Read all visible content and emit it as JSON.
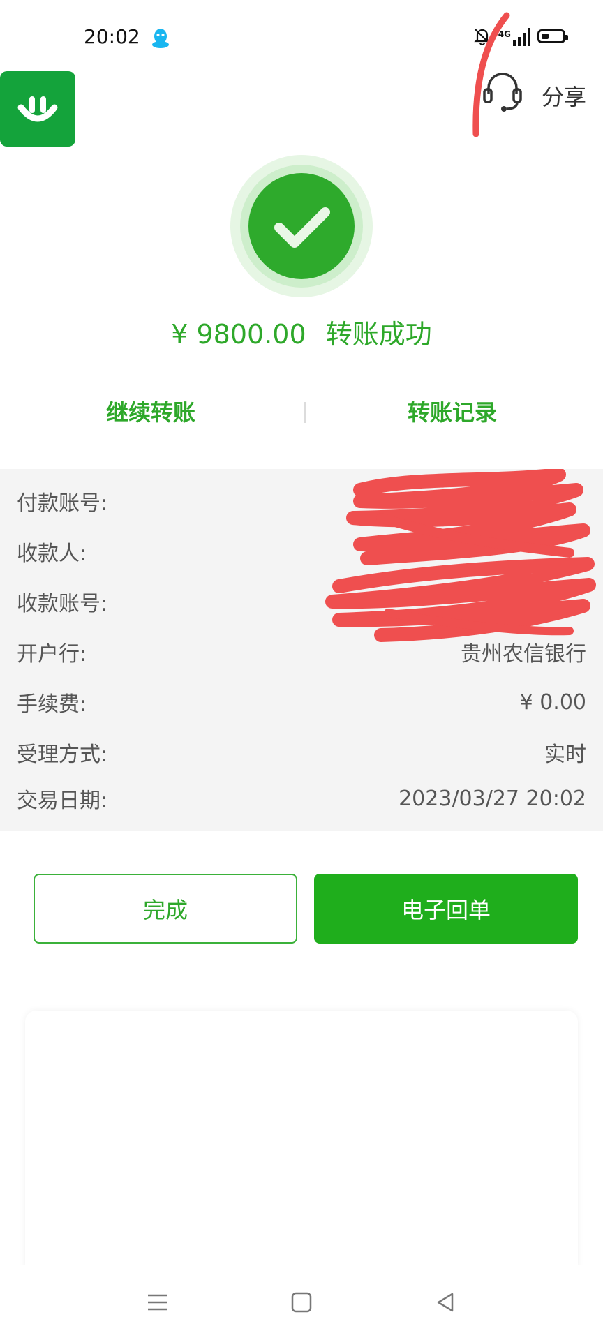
{
  "status_bar": {
    "time": "20:02",
    "network": "4G",
    "icons": [
      "qq-icon",
      "bell-off-icon",
      "signal-icon",
      "battery-icon"
    ]
  },
  "header": {
    "logo_icon": "smile-logo-icon",
    "support_icon": "headset-icon",
    "share_label": "分享"
  },
  "result": {
    "icon": "checkmark-icon",
    "amount": "¥ 9800.00",
    "status": "转账成功"
  },
  "actions": {
    "continue_label": "继续转账",
    "records_label": "转账记录"
  },
  "details": [
    {
      "label": "付款账号:",
      "value": "",
      "redacted": true
    },
    {
      "label": "收款人:",
      "value": "",
      "redacted": true
    },
    {
      "label": "收款账号:",
      "value": "",
      "redacted": true
    },
    {
      "label": "开户行:",
      "value": "贵州农信银行"
    },
    {
      "label": "手续费:",
      "value": "¥ 0.00"
    },
    {
      "label": "受理方式:",
      "value": "实时"
    },
    {
      "label": "交易日期:",
      "value": "2023/03/27 20:02"
    }
  ],
  "buttons": {
    "done_label": "完成",
    "receipt_label": "电子回单"
  },
  "colors": {
    "accent": "#2ea82a",
    "button_green": "#1fae1c",
    "logo_green": "#14a33b",
    "redaction": "#ef4f4f"
  },
  "navbar": {
    "icons": [
      "menu-icon",
      "home-icon",
      "back-icon"
    ]
  }
}
